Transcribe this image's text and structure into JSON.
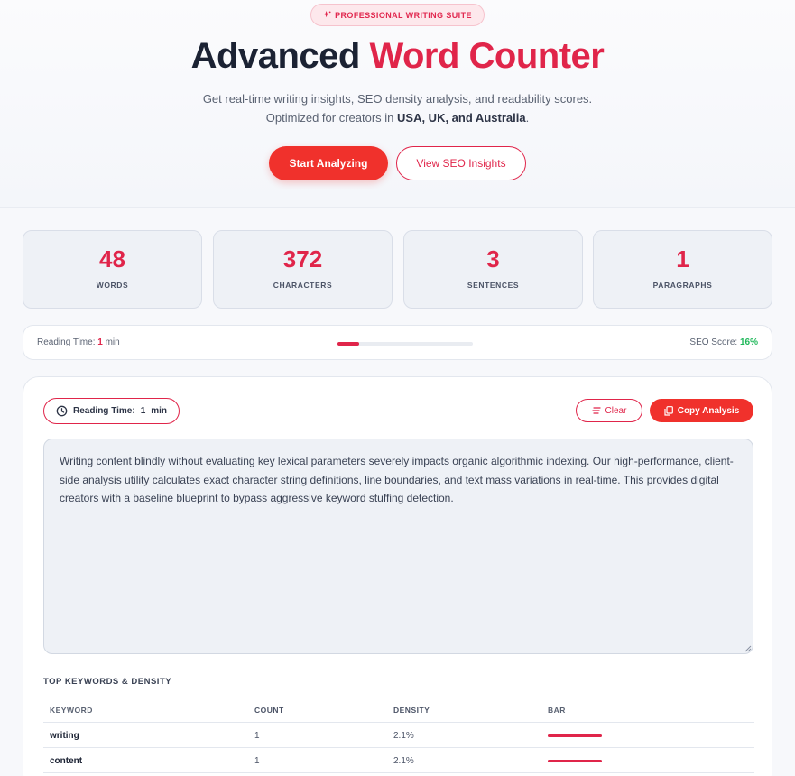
{
  "hero": {
    "badge": "PROFESSIONAL WRITING SUITE",
    "title_main": "Advanced",
    "title_accent": "Word Counter",
    "subtitle_line1": "Get real-time writing insights, SEO density analysis, and readability scores.",
    "subtitle_line2_prefix": "Optimized for creators in ",
    "subtitle_line2_bold": "USA, UK, and Australia",
    "subtitle_line2_suffix": ".",
    "primary_button": "Start Analyzing",
    "secondary_button": "View SEO Insights"
  },
  "stats": [
    {
      "value": "48",
      "label": "WORDS"
    },
    {
      "value": "372",
      "label": "CHARACTERS"
    },
    {
      "value": "3",
      "label": "SENTENCES"
    },
    {
      "value": "1",
      "label": "PARAGRAPHS"
    }
  ],
  "meter": {
    "reading_label": "Reading Time: ",
    "reading_value": "1",
    "reading_unit": " min",
    "seo_label": "SEO Score: ",
    "seo_value": "16%",
    "seo_fraction": 0.16
  },
  "panel": {
    "reading_pill_label": "Reading Time:",
    "reading_pill_value": "1",
    "reading_pill_unit": "min",
    "clear_button": "Clear",
    "copy_button": "Copy Analysis",
    "editor_text": "Writing content blindly without evaluating key lexical parameters severely impacts organic algorithmic indexing. Our high-performance, client-side analysis utility calculates exact character string definitions, line boundaries, and text mass variations in real-time. This provides digital creators with a baseline blueprint to bypass aggressive keyword stuffing detection."
  },
  "keywords": {
    "title": "TOP KEYWORDS & DENSITY",
    "headers": [
      "KEYWORD",
      "COUNT",
      "DENSITY",
      "BAR"
    ],
    "rows": [
      {
        "keyword": "writing",
        "count": "1",
        "density": "2.1%"
      },
      {
        "keyword": "content",
        "count": "1",
        "density": "2.1%"
      }
    ]
  },
  "colors": {
    "accent": "#e0254a",
    "primary_button": "#f0312c",
    "seo_green": "#1fb85a"
  }
}
